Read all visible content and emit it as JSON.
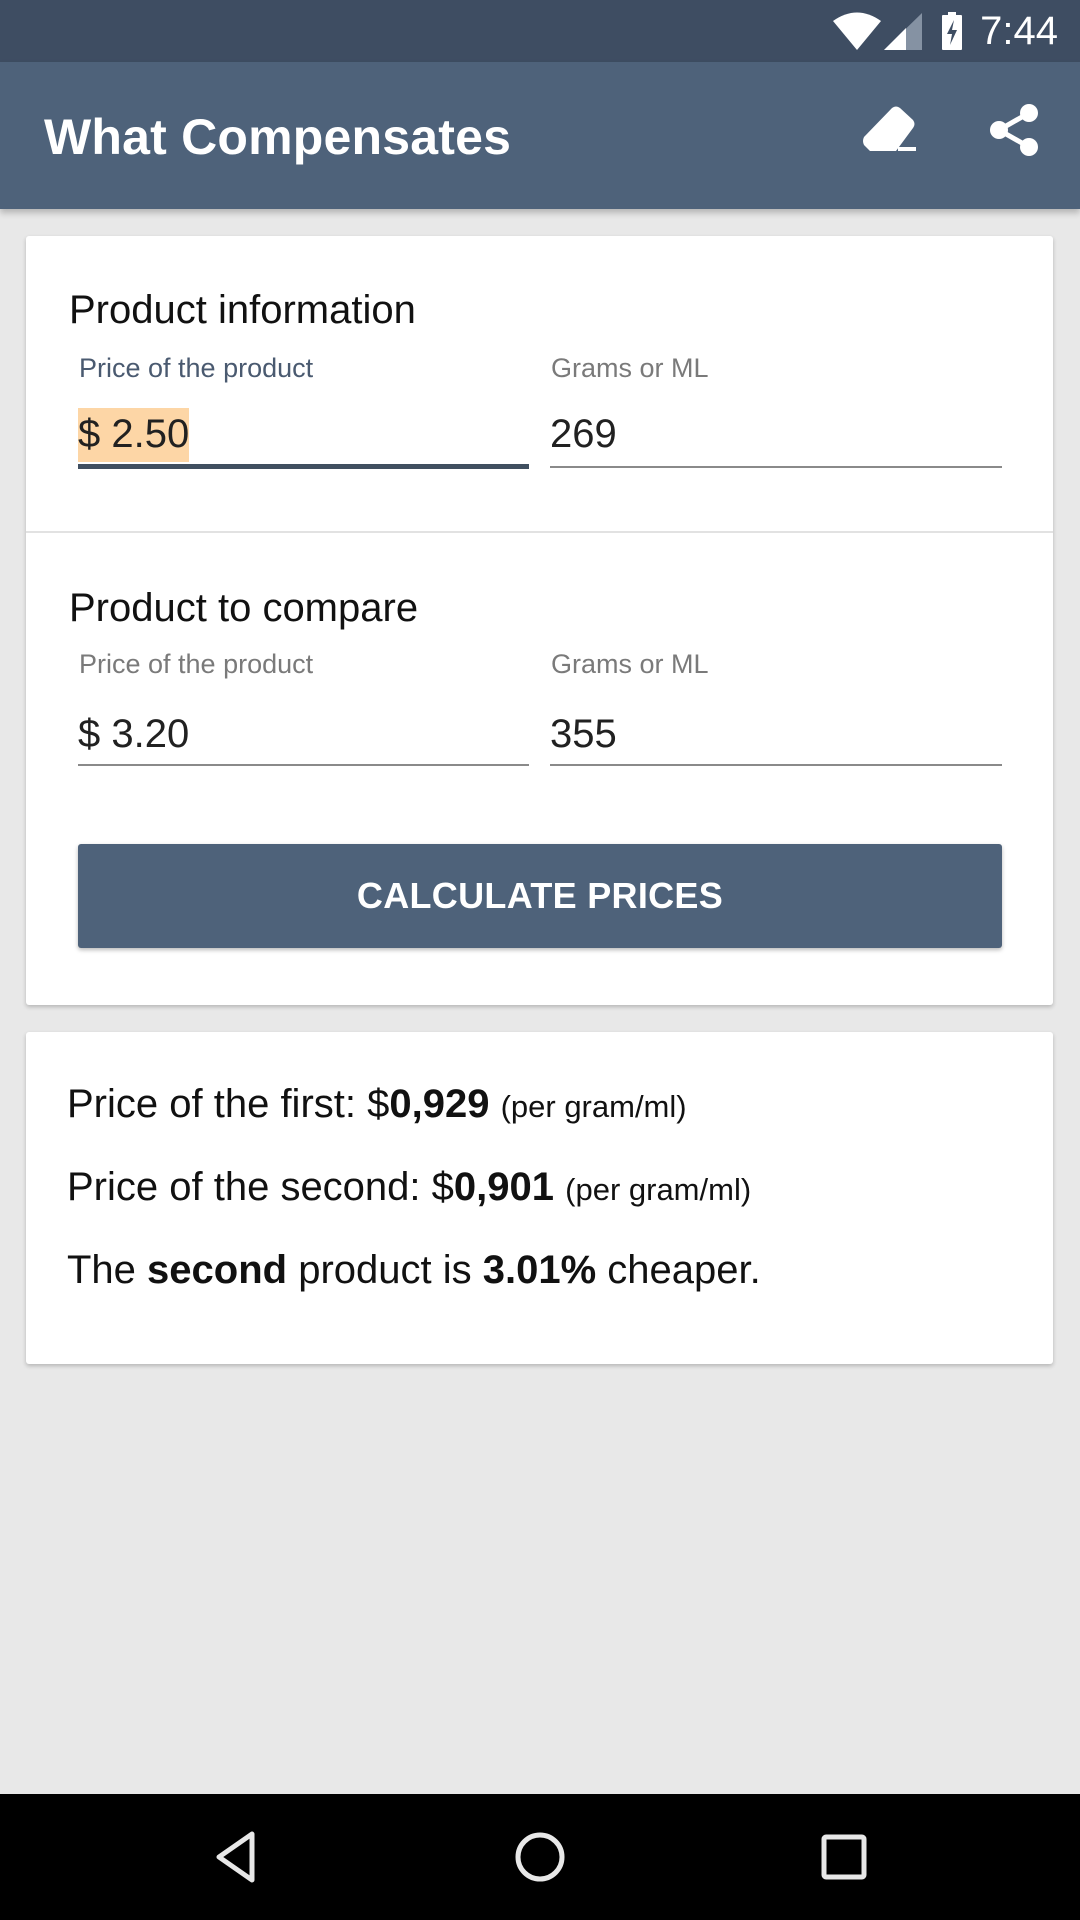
{
  "status_bar": {
    "time": "7:44",
    "icons": [
      "wifi-icon",
      "signal-icon",
      "battery-charging-icon"
    ]
  },
  "toolbar": {
    "title": "What Compensates",
    "actions": [
      {
        "name": "clear",
        "icon": "eraser-icon"
      },
      {
        "name": "share",
        "icon": "share-icon"
      }
    ]
  },
  "product_information": {
    "title": "Product information",
    "price_label": "Price of the product",
    "price_value": "$ 2.50",
    "amount_label": "Grams or ML",
    "amount_value": "269"
  },
  "product_to_compare": {
    "title": "Product to compare",
    "price_label": "Price of the product",
    "price_value": "$ 3.20",
    "amount_label": "Grams or ML",
    "amount_value": "355"
  },
  "calculate_button": {
    "label": "CALCULATE PRICES"
  },
  "results": {
    "first": {
      "prefix": "Price of the first: $",
      "value": "0,929",
      "unit": "(per gram/ml)"
    },
    "second": {
      "prefix": "Price of the second: $",
      "value": "0,901",
      "unit": "(per gram/ml)"
    },
    "summary": {
      "part1": "The ",
      "winner": "second",
      "part2": " product is ",
      "percent": "3.01%",
      "part3": " cheaper."
    }
  },
  "nav_bar": {
    "buttons": [
      "back-icon",
      "home-icon",
      "recents-icon"
    ]
  },
  "colors": {
    "primary": "#4e627a",
    "primary_dark": "#3e4d62",
    "background": "#e8e8e8",
    "selection_highlight": "#fdd6a6"
  }
}
